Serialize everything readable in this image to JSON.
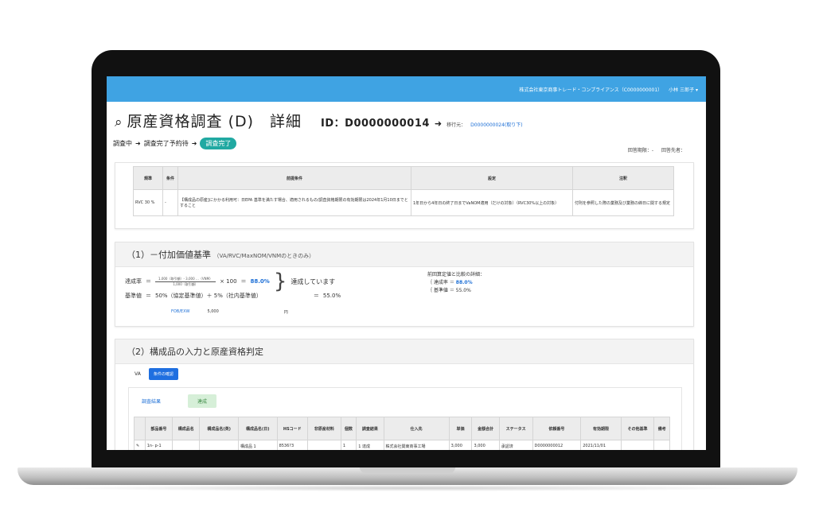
{
  "header": {
    "company": "株式会社東京商事トレード・コンプライアンス（C0000000001）",
    "user": "小林 三郎子 ▾"
  },
  "page": {
    "title": "原産資格調査 (D)　詳細",
    "id_label": "ID：D0000000014",
    "arrow": "➜",
    "prev_label": "移行元：",
    "prev_link": "D0000000024(取り下)"
  },
  "status_flow": [
    "調査中",
    "調査完了予約待",
    "調査完了"
  ],
  "meta": {
    "date_label": "回答期限：-",
    "submitter_label": "回答先者："
  },
  "condition_table": {
    "headers": [
      "規準",
      "条件",
      "前提条件",
      "設定",
      "注釈"
    ],
    "row": [
      "RVC 30 %",
      "-",
      "【構成品の原産]にかかる利用可：日EPA 基準を満たす場合、適用されるもの/調査資格期限の有効期限は2024年1月10日までとすること",
      "1年日から4年日の終了日までVaNOM適用（だけの対象）（RVC30%以上の対象）",
      "付則を参照した際の業務及び業務の締日に関する規定"
    ]
  },
  "section1": {
    "title": "（1）－付加価値基準",
    "subtitle": "（VA/RVC/MaxNOM/VNMのときのみ）",
    "rate_label": "達成率",
    "numerator": "1,000（取引額）- 3,000 …（VNM）",
    "denominator": "1,000（取引額）",
    "times100": "× 100",
    "rate_value": "88.0%",
    "base_label": "基準値",
    "base_formula": "50%（協定基準値）＋ 5%（社内基準値）",
    "base_value": "55.0%",
    "verdict": "達成しています",
    "side_title": "前回算定値と比較の詳細：",
    "side_rate_label": "達成率",
    "side_rate_value": "88.0%",
    "side_base_label": "基準値",
    "side_base_value": "55.0%",
    "fob_label": "FOB/EXW",
    "fob_value": "5,000",
    "fob_unit": "円"
  },
  "section2": {
    "title": "（2）構成品の入力と原産資格判定",
    "tab_va": "VA",
    "tab_button": "条件の確認",
    "result_label": "調査結果",
    "result_badge": "達成",
    "parts_headers": [
      "",
      "部品番号",
      "構成品名",
      "構成品名(英)",
      "構成品名(日)",
      "HSコード",
      "非原産材料",
      "個数",
      "調査結果",
      "仕入先",
      "単価",
      "金額合計",
      "ステータス",
      "依頼番号",
      "有効期限",
      "その他基準",
      "備考"
    ],
    "parts_row": [
      "✎",
      "1n- p-1",
      "",
      "",
      "構成品 1",
      "8536?3",
      "",
      "1",
      "1 達成",
      "株式会社関東商事工場",
      "3,000",
      "3,000",
      "承認済",
      "D0000000012",
      "2021/11/01",
      "",
      ""
    ]
  }
}
